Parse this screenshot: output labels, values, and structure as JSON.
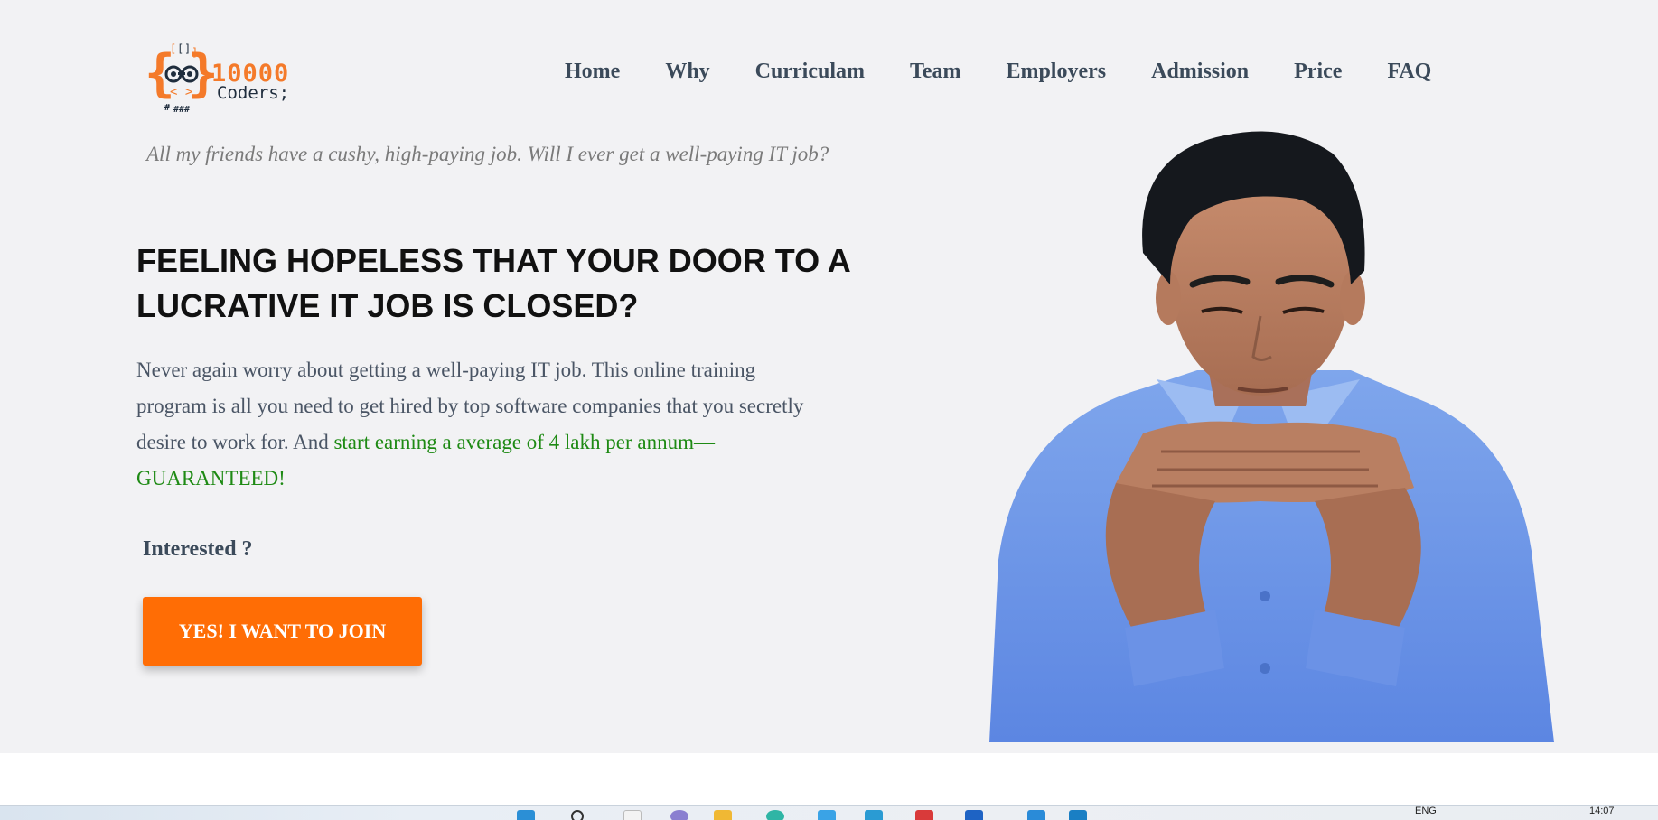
{
  "logo": {
    "line1": "10000",
    "line2": "Coders;"
  },
  "nav": {
    "items": [
      {
        "label": "Home"
      },
      {
        "label": "Why"
      },
      {
        "label": "Curriculam"
      },
      {
        "label": "Team"
      },
      {
        "label": "Employers"
      },
      {
        "label": "Admission"
      },
      {
        "label": "Price"
      },
      {
        "label": "FAQ"
      }
    ]
  },
  "hero": {
    "quote": "All my friends have a cushy, high-paying job. Will I ever get a well-paying IT job?",
    "headline": "FEELING HOPELESS THAT YOUR DOOR TO A LUCRATIVE IT JOB IS CLOSED?",
    "body_plain": "Never again worry about getting a well-paying IT job. This online training program is all you need to get hired by top software companies that you secretly desire to work for. And ",
    "body_highlight": "start earning a average of 4 lakh per annum—GUARANTEED!",
    "interested": "Interested ?",
    "cta_label": "YES! I WANT TO JOIN"
  },
  "taskbar": {
    "language": "ENG",
    "time": "14:07"
  },
  "colors": {
    "accent": "#ff6d05",
    "highlight_green": "#1e8a14",
    "logo_orange": "#f47a2a",
    "nav_text": "#3b4a5a",
    "page_bg": "#f2f2f4"
  }
}
